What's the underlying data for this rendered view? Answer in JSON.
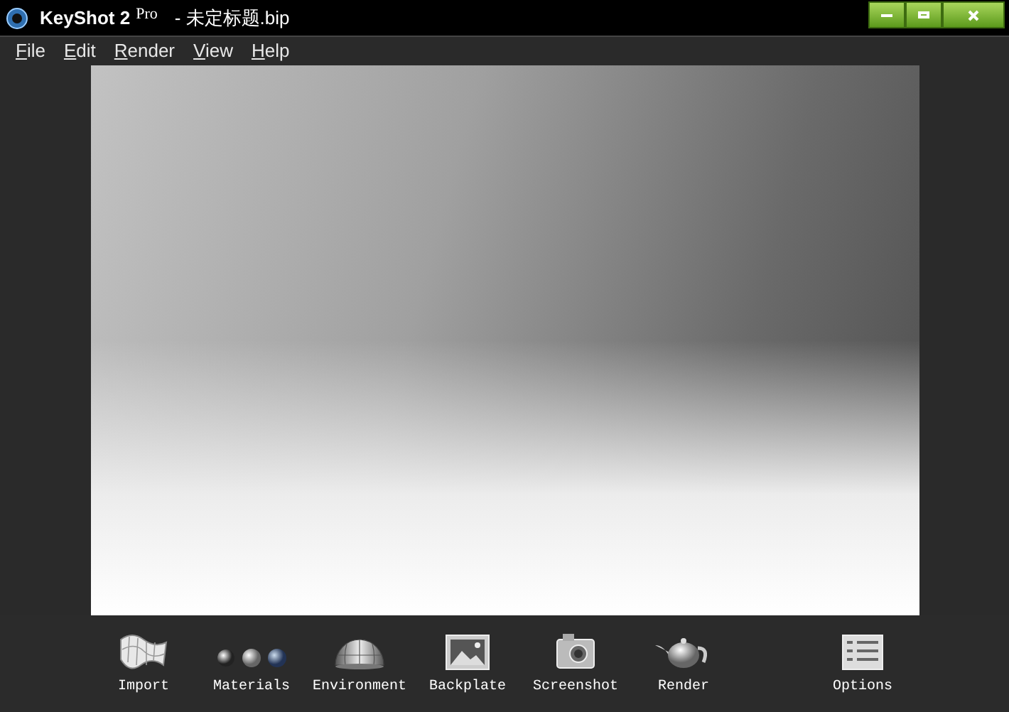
{
  "window": {
    "title": "KeyShot 2",
    "edition": "Pro",
    "document": "- 未定标题.bip"
  },
  "menu": [
    {
      "label": "File"
    },
    {
      "label": "Edit"
    },
    {
      "label": "Render"
    },
    {
      "label": "View"
    },
    {
      "label": "Help"
    }
  ],
  "toolbar": [
    {
      "kind": "import",
      "label": "Import"
    },
    {
      "kind": "materials",
      "label": "Materials"
    },
    {
      "kind": "environment",
      "label": "Environment"
    },
    {
      "kind": "backplate",
      "label": "Backplate"
    },
    {
      "kind": "screenshot",
      "label": "Screenshot"
    },
    {
      "kind": "render",
      "label": "Render"
    },
    {
      "kind": "options",
      "label": "Options"
    }
  ]
}
